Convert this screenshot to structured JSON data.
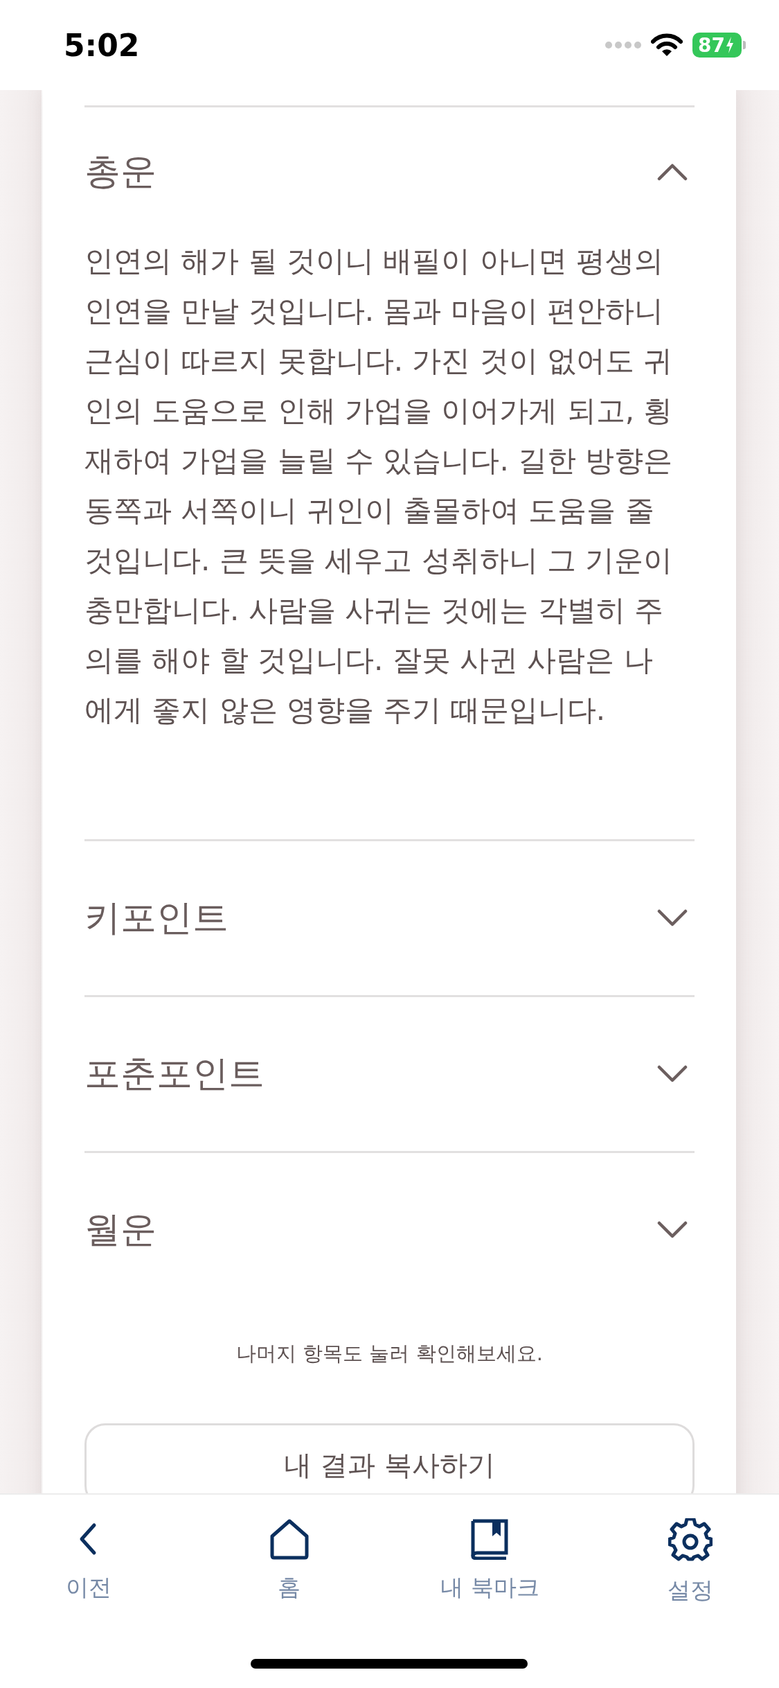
{
  "status_bar": {
    "time": "5:02",
    "battery": "87"
  },
  "sections": [
    {
      "title": "총운",
      "expanded": true,
      "body": "인연의 해가 될 것이니 배필이 아니면 평생의 인연을 만날 것입니다. 몸과 마음이 편안하니 근심이 따르지 못합니다. 가진 것이 없어도 귀인의 도움으로 인해 가업을 이어가게 되고, 횡재하여 가업을 늘릴 수 있습니다. 길한 방향은 동쪽과 서쪽이니 귀인이 출몰하여 도움을 줄 것입니다. 큰 뜻을 세우고 성취하니 그 기운이 충만합니다. 사람을 사귀는 것에는 각별히 주의를 해야 할 것입니다. 잘못 사귄 사람은 나에게 좋지 않은 영향을 주기 때문입니다."
    },
    {
      "title": "키포인트",
      "expanded": false
    },
    {
      "title": "포춘포인트",
      "expanded": false
    },
    {
      "title": "월운",
      "expanded": false
    }
  ],
  "note": "나머지 항목도 눌러 확인해보세요.",
  "copy_button": "내 결과 복사하기",
  "tab_bar": [
    {
      "kind": "back",
      "label": "이전"
    },
    {
      "kind": "home",
      "label": "홈"
    },
    {
      "kind": "bookmark",
      "label": "내 북마크"
    },
    {
      "kind": "settings",
      "label": "설정"
    }
  ]
}
